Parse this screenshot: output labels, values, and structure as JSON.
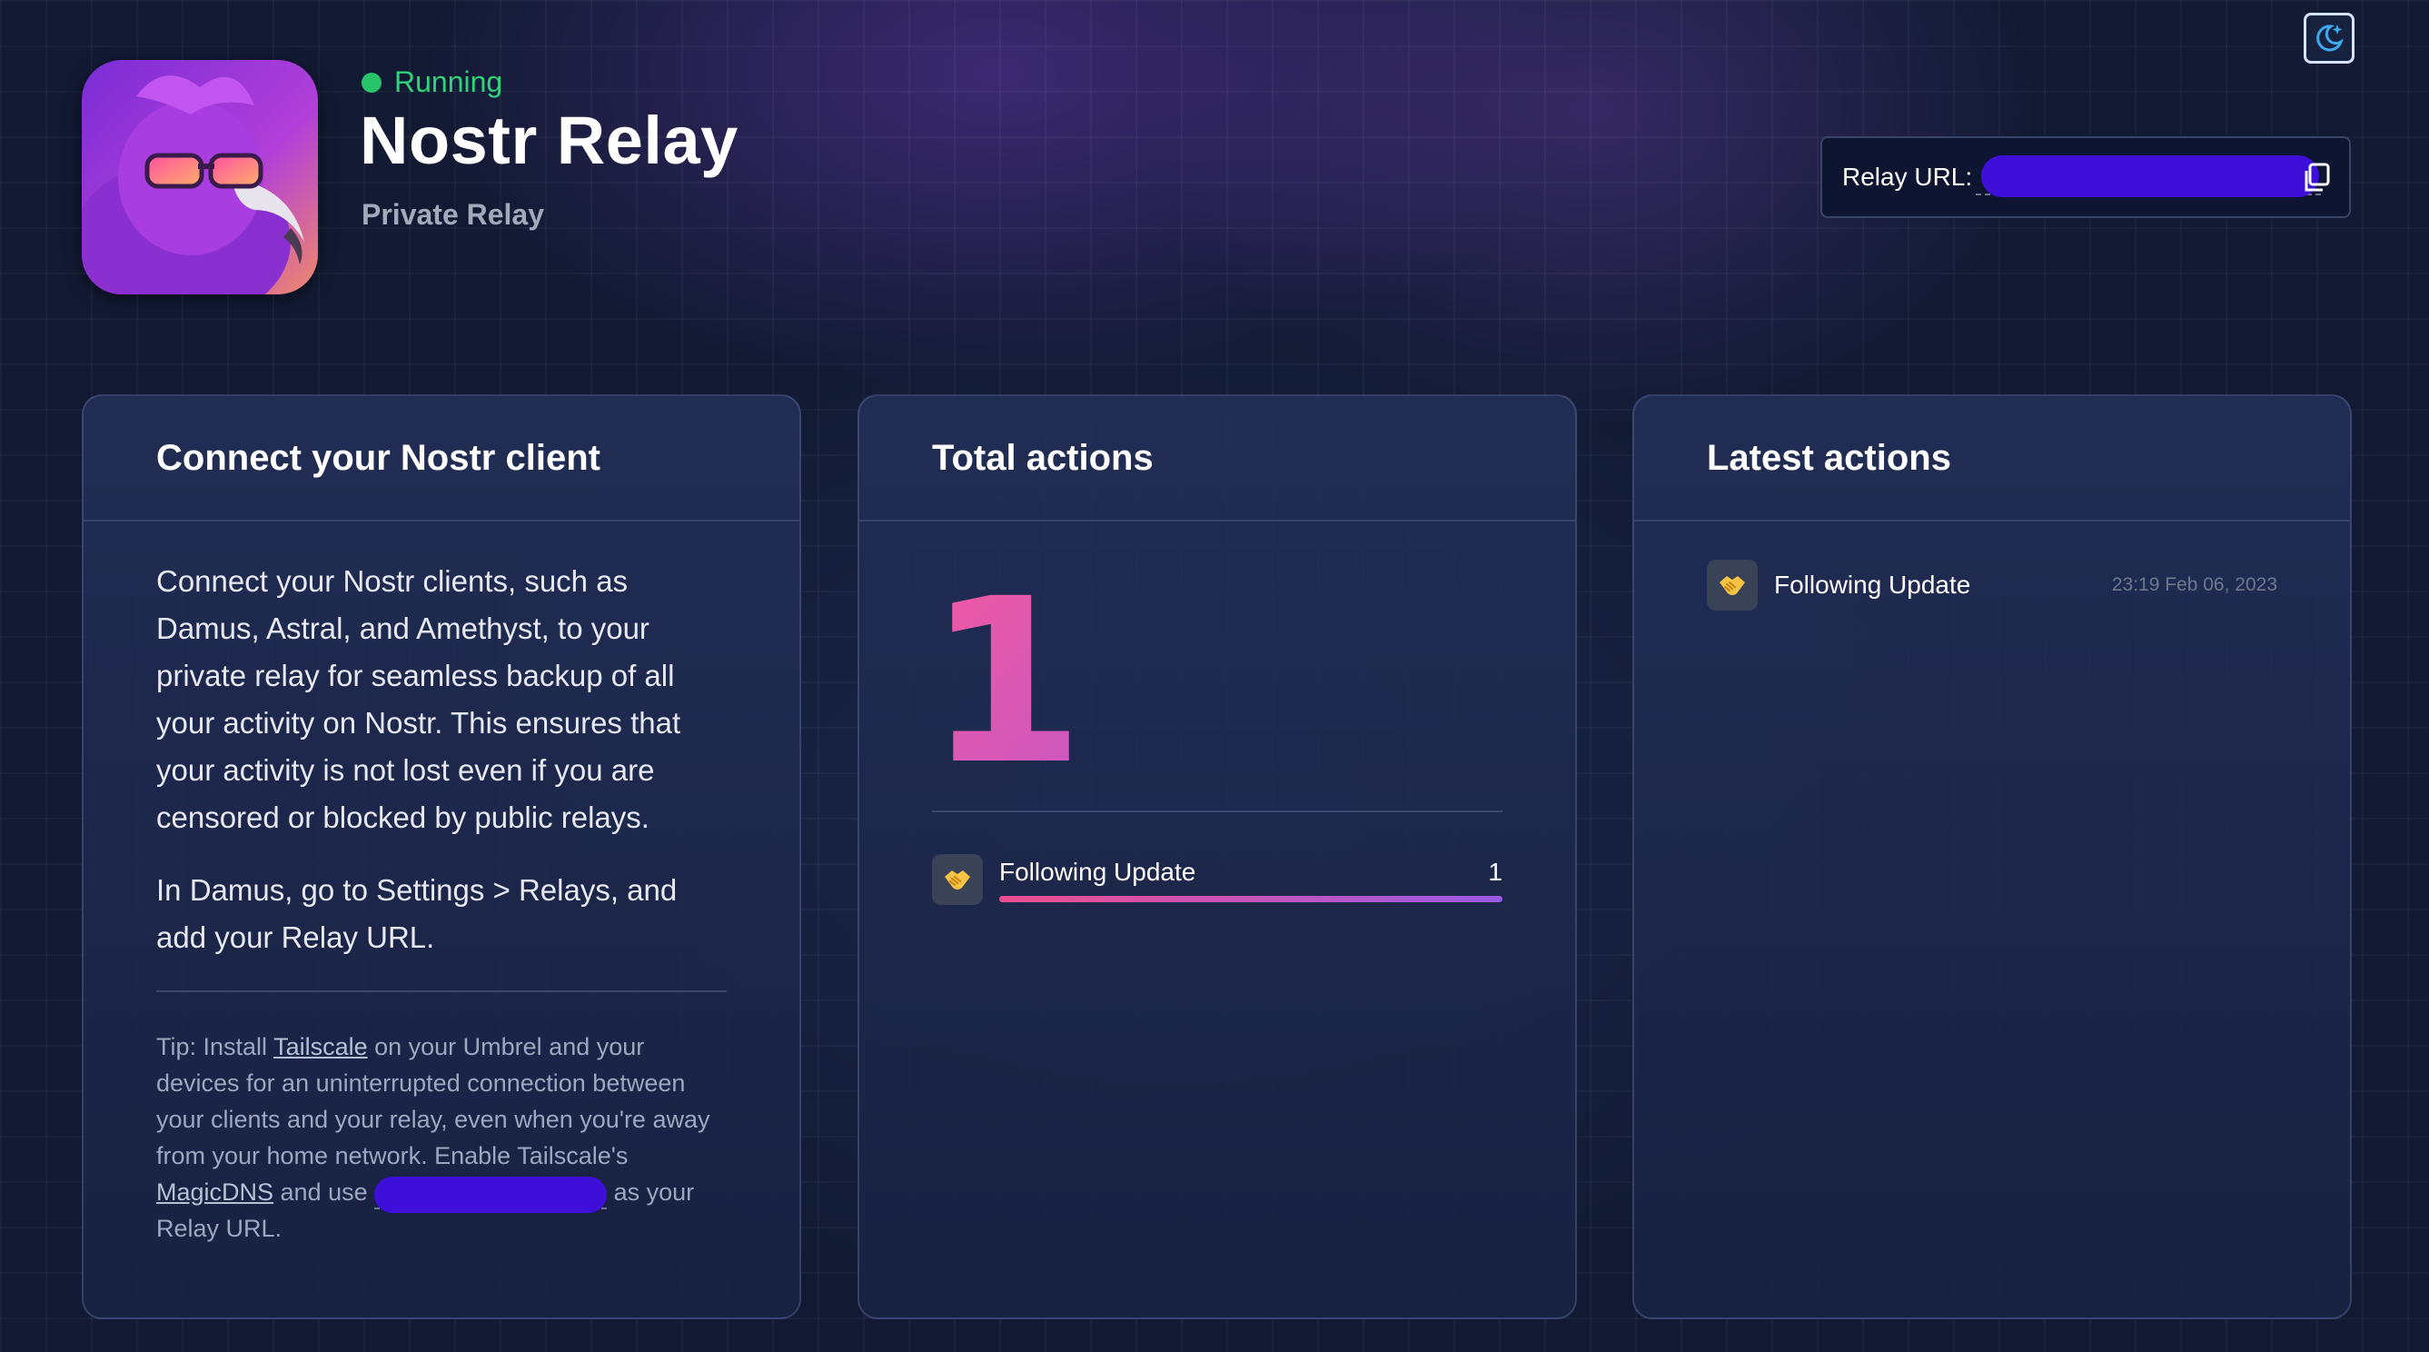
{
  "header": {
    "status": "Running",
    "status_color": "#27c46b",
    "title": "Nostr Relay",
    "subtitle": "Private Relay",
    "icon": "app-icon-purple-bird"
  },
  "relay_url": {
    "label": "Relay URL:",
    "copy_icon": "copy-icon"
  },
  "theme_toggle": {
    "icon": "moon-star-icon"
  },
  "connect_card": {
    "title": "Connect your Nostr client",
    "paragraph_1": "Connect your Nostr clients, such as Damus, Astral, and Amethyst, to your private relay for seamless backup of all your activity on Nostr. This ensures that your activity is not lost even if you are censored or blocked by public relays.",
    "paragraph_2": "In Damus, go to Settings > Relays, and add your Relay URL.",
    "tip": {
      "prefix": "Tip: Install ",
      "link_tailscale": "Tailscale",
      "middle": " on your Umbrel and your devices for an uninterrupted connection between your clients and your relay, even when you're away from your home network. Enable Tailscale's ",
      "link_magicdns": "MagicDNS",
      "and_use": " and use ",
      "suffix": " as your Relay URL."
    }
  },
  "total_card": {
    "title": "Total actions",
    "total": "1",
    "stats": [
      {
        "label": "Following Update",
        "count": "1",
        "icon": "handshake-icon",
        "fraction": 1.0
      }
    ]
  },
  "latest_card": {
    "title": "Latest actions",
    "items": [
      {
        "label": "Following Update",
        "time": "23:19 Feb 06, 2023",
        "icon": "handshake-icon"
      }
    ]
  },
  "colors": {
    "accent_gradient_start": "#ee4f8f",
    "accent_gradient_end": "#9a5be6",
    "redaction": "#3d0fd9"
  }
}
